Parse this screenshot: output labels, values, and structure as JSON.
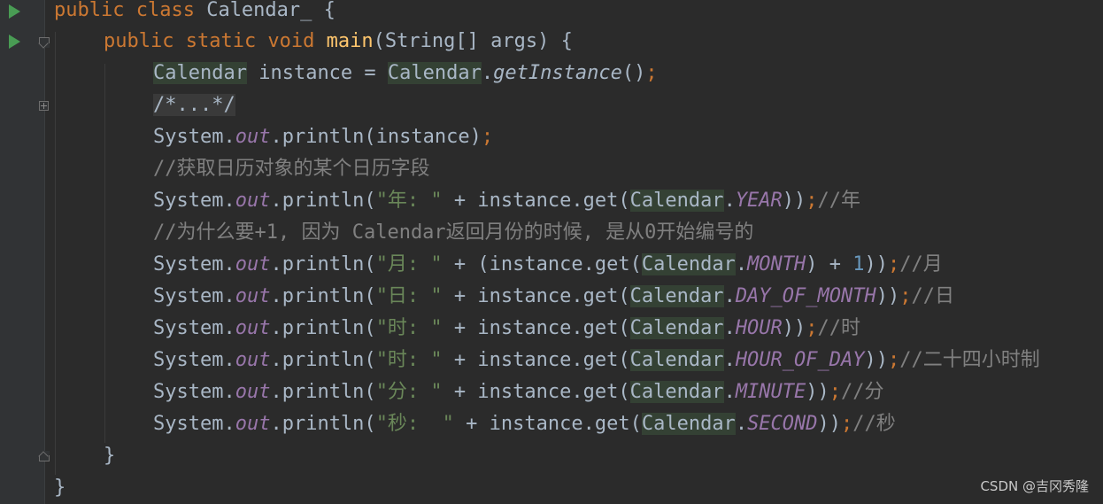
{
  "editor": {
    "lines": {
      "l1_kw": "public class",
      "l1_name": " Calendar_ {",
      "l2_kw": "public static void",
      "l2_fn": "main",
      "l2_rest": "(String[] args) {",
      "l3_type": "Calendar",
      "l3_mid": " instance = ",
      "l3_type2": "Calendar",
      "l3_dot": ".",
      "l3_method": "getInstance",
      "l3_end": "()",
      "semicolon": ";",
      "l4_fold": "/*...*/",
      "system": "System.",
      "out": "out",
      "println": ".println(",
      "l5_arg": "instance)",
      "l6_comment": "//获取日历对象的某个日历字段",
      "l7_str": "\"年: \"",
      "plus_get": " + instance.get(",
      "calendar": "Calendar",
      "dot": ".",
      "year": "YEAR",
      "close2": "))",
      "l7_comment": "//年",
      "l8_comment": "//为什么要+1, 因为 Calendar返回月份的时候, 是从0开始编号的",
      "l9_str": "\"月: \"",
      "plus_paren_get": " + (instance.get(",
      "month": "MONTH",
      "plus_one_pre": ") + ",
      "one": "1",
      "l9_close": "))",
      "l9_comment": "//月",
      "l10_str": "\"日: \"",
      "day_of_month": "DAY_OF_MONTH",
      "l10_comment": "//日",
      "l11_str": "\"时: \"",
      "hour": "HOUR",
      "l11_comment": "//时",
      "l12_str": "\"时: \"",
      "hour_of_day": "HOUR_OF_DAY",
      "l12_comment": "//二十四小时制",
      "l13_str": "\"分: \"",
      "minute": "MINUTE",
      "l13_comment": "//分",
      "l14_str": "\"秒:  \"",
      "second": "SECOND",
      "l14_comment": "//秒",
      "l15": "}",
      "l16": "}"
    }
  },
  "watermark": "CSDN @吉冈秀隆",
  "icons": {
    "run": "run-icon",
    "fold": "fold-icon"
  },
  "colors": {
    "background": "#2b2b2b",
    "keyword": "#cc7832",
    "string": "#6a8759",
    "field": "#9876aa",
    "function": "#ffc66d",
    "comment": "#808080",
    "number": "#6897bb"
  }
}
